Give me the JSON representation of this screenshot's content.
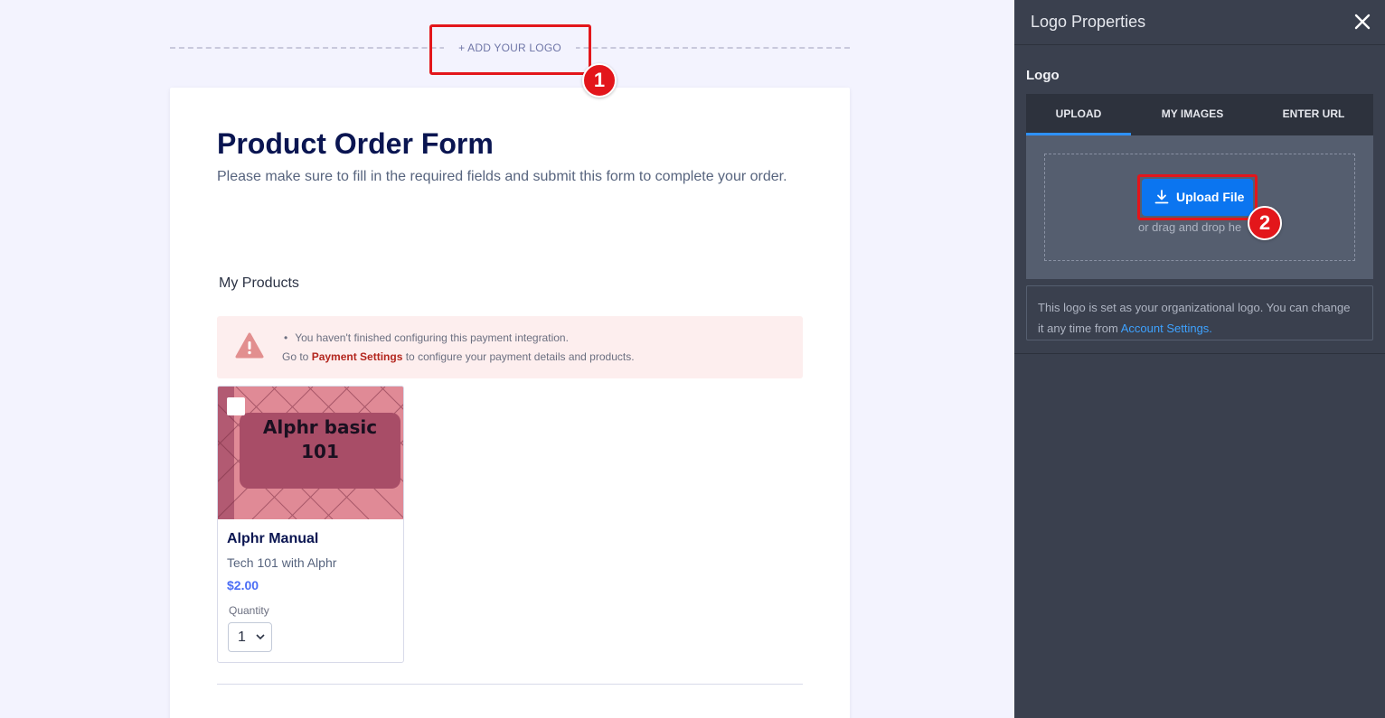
{
  "canvas": {
    "add_logo_label": "+ ADD YOUR LOGO",
    "form": {
      "title": "Product Order Form",
      "subtitle": "Please make sure to fill in the required fields and submit this form to complete your order.",
      "section_label": "My Products",
      "warning": {
        "icon": "warning-triangle-icon",
        "line1": "You haven't finished configuring this payment integration.",
        "line2_prefix": "Go to ",
        "line2_link": "Payment Settings",
        "line2_suffix": " to configure your payment details and products."
      },
      "product": {
        "image_text_line1": "Alphr basic",
        "image_text_line2": "101",
        "name": "Alphr Manual",
        "description": "Tech 101 with Alphr",
        "price": "$2.00",
        "quantity_label": "Quantity",
        "quantity_value": "1"
      }
    }
  },
  "annotations": {
    "step1": "1",
    "step2": "2"
  },
  "panel": {
    "title": "Logo Properties",
    "close_icon": "close-icon",
    "logo_label": "Logo",
    "tabs": [
      {
        "label": "UPLOAD",
        "active": true
      },
      {
        "label": "MY IMAGES",
        "active": false
      },
      {
        "label": "ENTER URL",
        "active": false
      }
    ],
    "upload_button": "Upload File",
    "drag_text": "or drag and drop he",
    "info_text": "This logo is set as your organizational logo. You can change it any time from ",
    "info_link": "Account Settings."
  },
  "colors": {
    "accent": "#0b75f0",
    "highlight": "#e3161b",
    "panel_bg": "#3a404e",
    "link": "#3ea2ff",
    "price": "#4c6ef5"
  }
}
